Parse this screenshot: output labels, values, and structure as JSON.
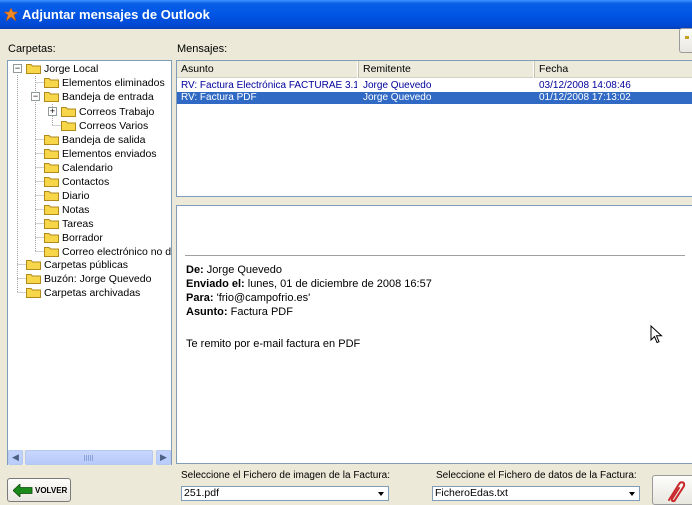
{
  "window": {
    "title": "Adjuntar mensajes de Outlook"
  },
  "labels": {
    "folders": "Carpetas:",
    "messages": "Mensajes:",
    "image_file": "Seleccione el Fichero de imagen de la Factura:",
    "data_file": "Seleccione el Fichero de datos de la Factura:"
  },
  "tree": [
    {
      "label": "Jorge Local",
      "expander": "−"
    },
    {
      "label": "Elementos eliminados"
    },
    {
      "label": "Bandeja de entrada",
      "expander": "−"
    },
    {
      "label": "Correos Trabajo",
      "expander": "+"
    },
    {
      "label": "Correos Varios"
    },
    {
      "label": "Bandeja de salida"
    },
    {
      "label": "Elementos enviados"
    },
    {
      "label": "Calendario"
    },
    {
      "label": "Contactos"
    },
    {
      "label": "Diario"
    },
    {
      "label": "Notas"
    },
    {
      "label": "Tareas"
    },
    {
      "label": "Borrador"
    },
    {
      "label": "Correo electrónico no des"
    },
    {
      "label": "Carpetas públicas"
    },
    {
      "label": "Buzón: Jorge Quevedo"
    },
    {
      "label": "Carpetas archivadas"
    }
  ],
  "messages": {
    "columns": [
      "Asunto",
      "Remitente",
      "Fecha"
    ],
    "rows": [
      {
        "subject": "RV: Factura Electrónica FACTURAE 3.1",
        "sender": "Jorge Quevedo",
        "date": "03/12/2008 14:08:46",
        "selected": false
      },
      {
        "subject": "RV: Factura PDF",
        "sender": "Jorge Quevedo",
        "date": "01/12/2008 17:13:02",
        "selected": true
      }
    ]
  },
  "preview": {
    "from_label": "De:",
    "from": "Jorge Quevedo",
    "sent_label": "Enviado el:",
    "sent": "lunes, 01 de diciembre de 2008 16:57",
    "to_label": "Para:",
    "to": "'frio@campofrio.es'",
    "subject_label": "Asunto:",
    "subject": "Factura PDF",
    "body": "Te remito por e-mail factura en PDF"
  },
  "controls": {
    "back_label": "VOLVER",
    "image_file_value": "251.pdf",
    "data_file_value": "FicheroEdas.txt"
  },
  "colors": {
    "selection": "#316ac5",
    "title": "#0055e5",
    "folder": "#f7d64a",
    "link_text": "#00009c"
  }
}
